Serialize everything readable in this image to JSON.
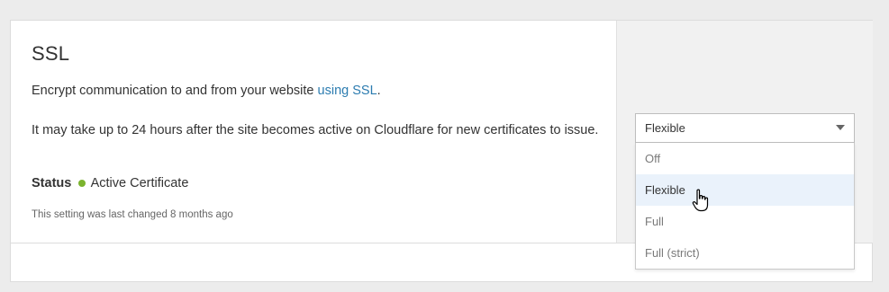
{
  "ssl": {
    "title": "SSL",
    "description_prefix": "Encrypt communication to and from your website ",
    "description_link": "using SSL",
    "description_suffix": ".",
    "note": "It may take up to 24 hours after the site becomes active on Cloudflare for new certificates to issue.",
    "status_label": "Status",
    "status_value": "Active Certificate",
    "status_color": "#7bb32e",
    "last_changed": "This setting was last changed 8 months ago"
  },
  "dropdown": {
    "selected": "Flexible",
    "options": [
      "Off",
      "Flexible",
      "Full",
      "Full (strict)"
    ],
    "highlighted_option": "Flexible"
  },
  "footer": {
    "glyph": "›"
  },
  "colors": {
    "link": "#2c7cb0",
    "highlight": "#eaf2fb"
  }
}
